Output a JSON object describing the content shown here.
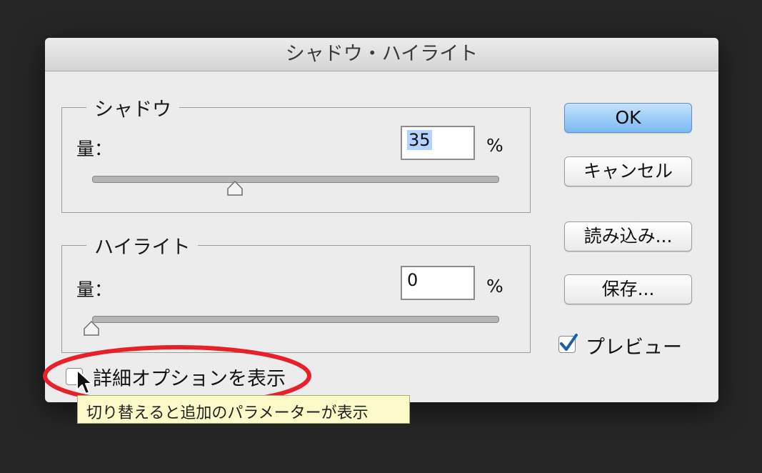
{
  "dialog": {
    "title": "シャドウ・ハイライト",
    "shadows": {
      "legend": "シャドウ",
      "amount_label": "量：",
      "amount_value": "35",
      "unit": "%",
      "slider_value": 35
    },
    "highlights": {
      "legend": "ハイライト",
      "amount_label": "量：",
      "amount_value": "0",
      "unit": "%",
      "slider_value": 0
    },
    "buttons": {
      "ok": "OK",
      "cancel": "キャンセル",
      "load": "読み込み...",
      "save": "保存..."
    },
    "preview": {
      "label": "プレビュー",
      "checked": true
    },
    "more_options": {
      "label": "詳細オプションを表示",
      "checked": false
    }
  },
  "tooltip": {
    "text": "切り替えると追加のパラメーターが表示"
  },
  "annotation": {
    "ellipse_color": "#e8202a"
  },
  "colors": {
    "accent": "#7ab9f3",
    "selection": "#b4d4ff",
    "tooltip_bg": "#fbfac8"
  }
}
